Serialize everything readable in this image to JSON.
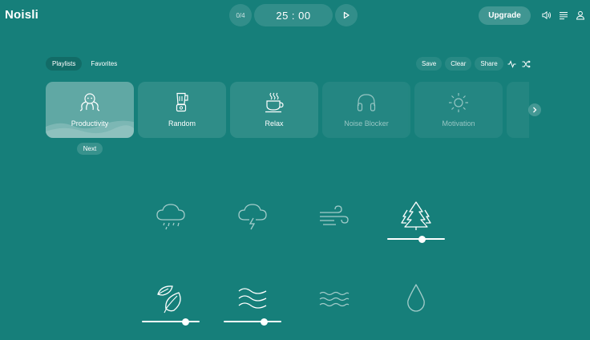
{
  "app": {
    "logo": "Noisli"
  },
  "timer": {
    "sessions": "0/4",
    "time": "25 : 00"
  },
  "header": {
    "upgrade_label": "Upgrade"
  },
  "tabs": [
    {
      "label": "Playlists",
      "active": true
    },
    {
      "label": "Favorites",
      "active": false
    }
  ],
  "actions": {
    "save": "Save",
    "clear": "Clear",
    "share": "Share"
  },
  "playlists": [
    {
      "label": "Productivity",
      "icon": "octopus-icon",
      "selected": true
    },
    {
      "label": "Random",
      "icon": "blender-icon",
      "selected": false
    },
    {
      "label": "Relax",
      "icon": "coffee-cup-icon",
      "selected": false
    },
    {
      "label": "Noise Blocker",
      "icon": "headphones-icon",
      "selected": false
    },
    {
      "label": "Motivation",
      "icon": "sun-icon",
      "selected": false
    }
  ],
  "next_label": "Next",
  "sounds": [
    {
      "icon": "rain-icon",
      "active": false
    },
    {
      "icon": "thunderstorm-icon",
      "active": false
    },
    {
      "icon": "wind-icon",
      "active": false
    },
    {
      "icon": "forest-icon",
      "active": true,
      "volume": 0.6
    },
    {
      "icon": "leaf-icon",
      "active": true,
      "volume": 0.75
    },
    {
      "icon": "water-stream-icon",
      "active": true,
      "volume": 0.7
    },
    {
      "icon": "waves-icon",
      "active": false
    },
    {
      "icon": "water-drop-icon",
      "active": false
    }
  ],
  "colors": {
    "background": "#167f7a",
    "foreground": "#ffffff"
  }
}
